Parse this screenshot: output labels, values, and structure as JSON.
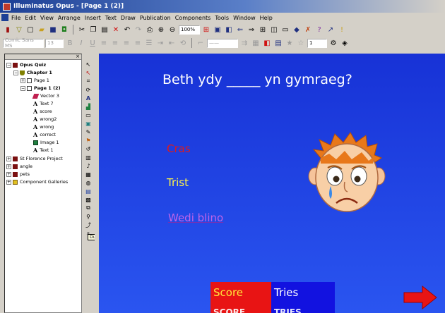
{
  "window": {
    "title": "Illuminatus Opus - [Page 1 (2)]"
  },
  "menu": [
    "File",
    "Edit",
    "View",
    "Arrange",
    "Insert",
    "Text",
    "Draw",
    "Publication",
    "Components",
    "Tools",
    "Window",
    "Help"
  ],
  "toolbar": {
    "zoom_value": "100%",
    "font_name": "Comic Sans MS",
    "font_size": "13",
    "line_width": "1"
  },
  "tree": {
    "items": [
      {
        "label": "Opus Quiz",
        "icon": "publication-icon"
      },
      {
        "label": "Chapter 1",
        "icon": "chapter-icon"
      },
      {
        "label": "Page 1",
        "icon": "page-icon"
      },
      {
        "label": "Page 1 (2)",
        "icon": "page-icon"
      },
      {
        "label": "Vector 3",
        "icon": "vector-icon"
      },
      {
        "label": "Text 7",
        "icon": "text-icon"
      },
      {
        "label": "score",
        "icon": "text-icon"
      },
      {
        "label": "wrong2",
        "icon": "text-icon"
      },
      {
        "label": "wrong",
        "icon": "text-icon"
      },
      {
        "label": "correct",
        "icon": "text-icon"
      },
      {
        "label": "Image 1",
        "icon": "image-icon"
      },
      {
        "label": "Text 1",
        "icon": "text-icon"
      },
      {
        "label": "St Florence Project",
        "icon": "publication-icon"
      },
      {
        "label": "angle",
        "icon": "publication-icon"
      },
      {
        "label": "pets",
        "icon": "publication-icon"
      },
      {
        "label": "Component Galleries",
        "icon": "gallery-icon"
      }
    ]
  },
  "tooltip": "Duplicate",
  "stage": {
    "question": "Beth ydy _____ yn gymraeg?",
    "answers": [
      "Cras",
      "Trist",
      "Wedi blino"
    ],
    "score_label": "Score",
    "tries_label": "Tries",
    "score_value": "SCORE",
    "tries_value": "TRIES"
  },
  "colors": {
    "stage_bg": "#1f3fe6",
    "answer_wrong": "#e01a1a",
    "answer_yellow": "#fff44a",
    "answer_purple": "#c064e8",
    "score_bg": "#e81414",
    "tries_bg": "#1212e0"
  }
}
